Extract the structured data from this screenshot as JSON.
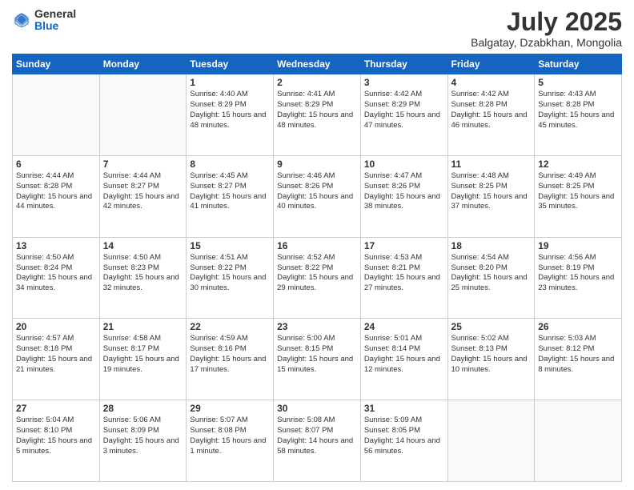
{
  "logo": {
    "general": "General",
    "blue": "Blue"
  },
  "title": "July 2025",
  "subtitle": "Balgatay, Dzabkhan, Mongolia",
  "days_of_week": [
    "Sunday",
    "Monday",
    "Tuesday",
    "Wednesday",
    "Thursday",
    "Friday",
    "Saturday"
  ],
  "weeks": [
    [
      {
        "day": "",
        "info": ""
      },
      {
        "day": "",
        "info": ""
      },
      {
        "day": "1",
        "info": "Sunrise: 4:40 AM\nSunset: 8:29 PM\nDaylight: 15 hours and 48 minutes."
      },
      {
        "day": "2",
        "info": "Sunrise: 4:41 AM\nSunset: 8:29 PM\nDaylight: 15 hours and 48 minutes."
      },
      {
        "day": "3",
        "info": "Sunrise: 4:42 AM\nSunset: 8:29 PM\nDaylight: 15 hours and 47 minutes."
      },
      {
        "day": "4",
        "info": "Sunrise: 4:42 AM\nSunset: 8:28 PM\nDaylight: 15 hours and 46 minutes."
      },
      {
        "day": "5",
        "info": "Sunrise: 4:43 AM\nSunset: 8:28 PM\nDaylight: 15 hours and 45 minutes."
      }
    ],
    [
      {
        "day": "6",
        "info": "Sunrise: 4:44 AM\nSunset: 8:28 PM\nDaylight: 15 hours and 44 minutes."
      },
      {
        "day": "7",
        "info": "Sunrise: 4:44 AM\nSunset: 8:27 PM\nDaylight: 15 hours and 42 minutes."
      },
      {
        "day": "8",
        "info": "Sunrise: 4:45 AM\nSunset: 8:27 PM\nDaylight: 15 hours and 41 minutes."
      },
      {
        "day": "9",
        "info": "Sunrise: 4:46 AM\nSunset: 8:26 PM\nDaylight: 15 hours and 40 minutes."
      },
      {
        "day": "10",
        "info": "Sunrise: 4:47 AM\nSunset: 8:26 PM\nDaylight: 15 hours and 38 minutes."
      },
      {
        "day": "11",
        "info": "Sunrise: 4:48 AM\nSunset: 8:25 PM\nDaylight: 15 hours and 37 minutes."
      },
      {
        "day": "12",
        "info": "Sunrise: 4:49 AM\nSunset: 8:25 PM\nDaylight: 15 hours and 35 minutes."
      }
    ],
    [
      {
        "day": "13",
        "info": "Sunrise: 4:50 AM\nSunset: 8:24 PM\nDaylight: 15 hours and 34 minutes."
      },
      {
        "day": "14",
        "info": "Sunrise: 4:50 AM\nSunset: 8:23 PM\nDaylight: 15 hours and 32 minutes."
      },
      {
        "day": "15",
        "info": "Sunrise: 4:51 AM\nSunset: 8:22 PM\nDaylight: 15 hours and 30 minutes."
      },
      {
        "day": "16",
        "info": "Sunrise: 4:52 AM\nSunset: 8:22 PM\nDaylight: 15 hours and 29 minutes."
      },
      {
        "day": "17",
        "info": "Sunrise: 4:53 AM\nSunset: 8:21 PM\nDaylight: 15 hours and 27 minutes."
      },
      {
        "day": "18",
        "info": "Sunrise: 4:54 AM\nSunset: 8:20 PM\nDaylight: 15 hours and 25 minutes."
      },
      {
        "day": "19",
        "info": "Sunrise: 4:56 AM\nSunset: 8:19 PM\nDaylight: 15 hours and 23 minutes."
      }
    ],
    [
      {
        "day": "20",
        "info": "Sunrise: 4:57 AM\nSunset: 8:18 PM\nDaylight: 15 hours and 21 minutes."
      },
      {
        "day": "21",
        "info": "Sunrise: 4:58 AM\nSunset: 8:17 PM\nDaylight: 15 hours and 19 minutes."
      },
      {
        "day": "22",
        "info": "Sunrise: 4:59 AM\nSunset: 8:16 PM\nDaylight: 15 hours and 17 minutes."
      },
      {
        "day": "23",
        "info": "Sunrise: 5:00 AM\nSunset: 8:15 PM\nDaylight: 15 hours and 15 minutes."
      },
      {
        "day": "24",
        "info": "Sunrise: 5:01 AM\nSunset: 8:14 PM\nDaylight: 15 hours and 12 minutes."
      },
      {
        "day": "25",
        "info": "Sunrise: 5:02 AM\nSunset: 8:13 PM\nDaylight: 15 hours and 10 minutes."
      },
      {
        "day": "26",
        "info": "Sunrise: 5:03 AM\nSunset: 8:12 PM\nDaylight: 15 hours and 8 minutes."
      }
    ],
    [
      {
        "day": "27",
        "info": "Sunrise: 5:04 AM\nSunset: 8:10 PM\nDaylight: 15 hours and 5 minutes."
      },
      {
        "day": "28",
        "info": "Sunrise: 5:06 AM\nSunset: 8:09 PM\nDaylight: 15 hours and 3 minutes."
      },
      {
        "day": "29",
        "info": "Sunrise: 5:07 AM\nSunset: 8:08 PM\nDaylight: 15 hours and 1 minute."
      },
      {
        "day": "30",
        "info": "Sunrise: 5:08 AM\nSunset: 8:07 PM\nDaylight: 14 hours and 58 minutes."
      },
      {
        "day": "31",
        "info": "Sunrise: 5:09 AM\nSunset: 8:05 PM\nDaylight: 14 hours and 56 minutes."
      },
      {
        "day": "",
        "info": ""
      },
      {
        "day": "",
        "info": ""
      }
    ]
  ]
}
